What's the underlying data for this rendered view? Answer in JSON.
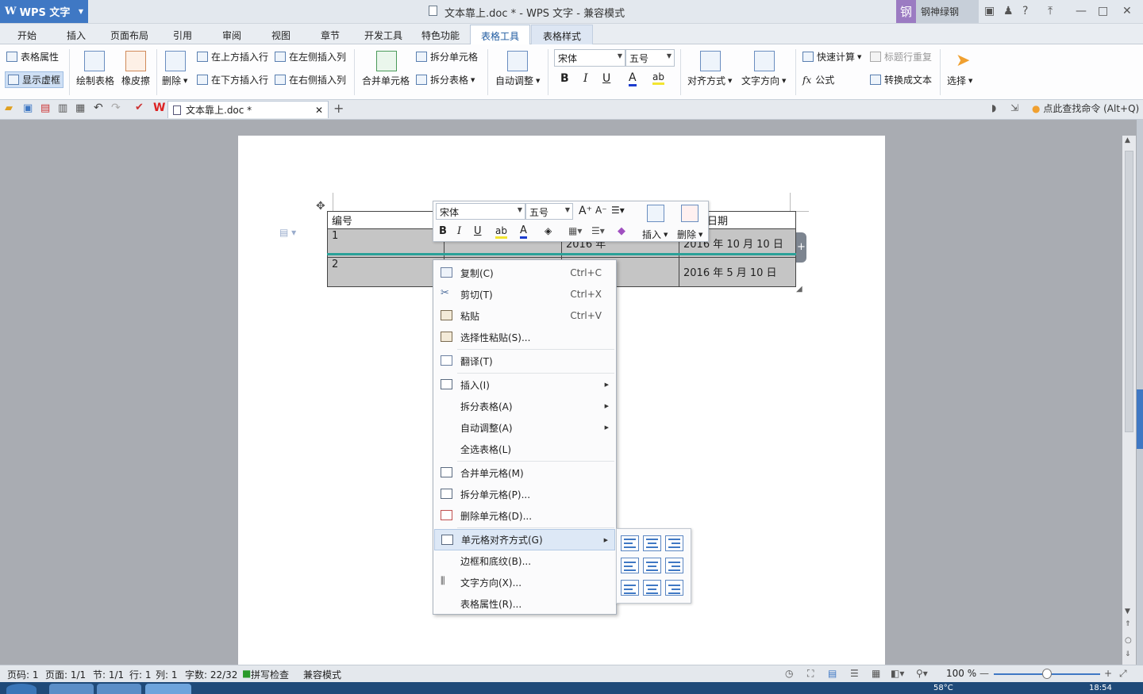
{
  "app": {
    "name": "WPS 文字",
    "window_title": "文本靠上.doc * - WPS 文字 - 兼容模式",
    "user": "钢神绿钢",
    "avatar": "钢"
  },
  "tabs": [
    "开始",
    "插入",
    "页面布局",
    "引用",
    "审阅",
    "视图",
    "章节",
    "开发工具",
    "特色功能",
    "表格工具",
    "表格样式"
  ],
  "ribbon": {
    "table_props": "表格属性",
    "show_grid": "显示虚框",
    "draw_table": "绘制表格",
    "eraser": "橡皮擦",
    "delete": "删除",
    "ins_row_above": "在上方插入行",
    "ins_row_below": "在下方插入行",
    "ins_col_left": "在左侧插入列",
    "ins_col_right": "在右侧插入列",
    "merge": "合并单元格",
    "split_cell": "拆分单元格",
    "split_table": "拆分表格",
    "auto_fit": "自动调整",
    "font": "宋体",
    "size": "五号",
    "align": "对齐方式",
    "text_dir": "文字方向",
    "quick_calc": "快速计算",
    "header_repeat": "标题行重复",
    "formula": "公式",
    "to_text": "转换成文本",
    "select": "选择"
  },
  "quickbar": {
    "doc_tab": "文本靠上.doc *",
    "search": "点此查找命令 (Alt+Q)"
  },
  "table": {
    "header": [
      "编号",
      "",
      "",
      "日期"
    ],
    "rows": [
      [
        "1",
        "",
        "",
        "2016 年 10 月 10 日"
      ],
      [
        "2",
        "",
        "",
        "2016 年 5 月 10 日"
      ]
    ],
    "partial": [
      "",
      "2016 年",
      ""
    ]
  },
  "mini_toolbar": {
    "font": "宋体",
    "size": "五号",
    "insert": "插入",
    "delete": "删除"
  },
  "context_menu": [
    {
      "label": "复制(C)",
      "shortcut": "Ctrl+C"
    },
    {
      "label": "剪切(T)",
      "shortcut": "Ctrl+X"
    },
    {
      "label": "粘贴",
      "shortcut": "Ctrl+V"
    },
    {
      "label": "选择性粘贴(S)...",
      "shortcut": ""
    },
    {
      "label": "翻译(T)",
      "shortcut": ""
    },
    {
      "label": "插入(I)",
      "shortcut": ""
    },
    {
      "label": "拆分表格(A)",
      "shortcut": ""
    },
    {
      "label": "自动调整(A)",
      "shortcut": ""
    },
    {
      "label": "全选表格(L)",
      "shortcut": ""
    },
    {
      "label": "合并单元格(M)",
      "shortcut": ""
    },
    {
      "label": "拆分单元格(P)...",
      "shortcut": ""
    },
    {
      "label": "删除单元格(D)...",
      "shortcut": ""
    },
    {
      "label": "单元格对齐方式(G)",
      "shortcut": ""
    },
    {
      "label": "边框和底纹(B)...",
      "shortcut": ""
    },
    {
      "label": "文字方向(X)...",
      "shortcut": ""
    },
    {
      "label": "表格属性(R)...",
      "shortcut": ""
    }
  ],
  "status": {
    "page": "页码: 1",
    "pages": "页面: 1/1",
    "section": "节: 1/1",
    "line": "行: 1",
    "col": "列: 1",
    "words": "字数: 22/32",
    "spell": "拼写检查",
    "mode": "兼容模式",
    "zoom": "100 %"
  },
  "taskbar": {
    "temp": "58°C",
    "time": "18:54"
  },
  "colors": {
    "accent": "#3f78c4",
    "highlight_row": "#2aa198",
    "menu_hover": "#dde8f6"
  }
}
